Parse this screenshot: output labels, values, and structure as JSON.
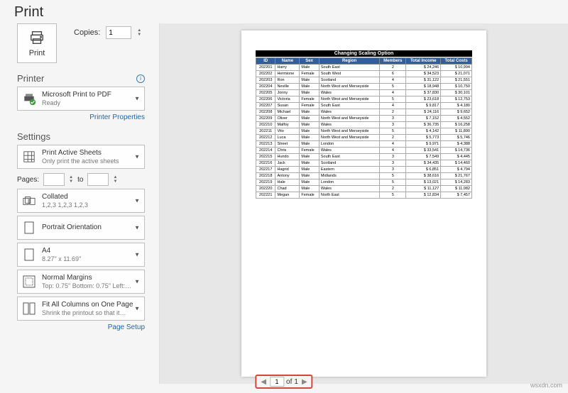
{
  "title": "Print",
  "printButton": "Print",
  "copiesLabel": "Copies:",
  "copiesValue": "1",
  "printerSection": "Printer",
  "printer": {
    "name": "Microsoft Print to PDF",
    "status": "Ready"
  },
  "printerPropsLink": "Printer Properties",
  "settingsSection": "Settings",
  "settings": {
    "activeSheets": {
      "t": "Print Active Sheets",
      "s": "Only print the active sheets"
    },
    "pagesLabel": "Pages:",
    "toLabel": "to",
    "collated": {
      "t": "Collated",
      "s": "1,2,3   1,2,3   1,2,3"
    },
    "orientation": {
      "t": "Portrait Orientation",
      "s": ""
    },
    "paper": {
      "t": "A4",
      "s": "8.27\" x 11.69\""
    },
    "margins": {
      "t": "Normal Margins",
      "s": "Top: 0.75\" Bottom: 0.75\" Left:…"
    },
    "scaling": {
      "t": "Fit All Columns on One Page",
      "s": "Shrink the printout so that it…"
    }
  },
  "pageSetupLink": "Page Setup",
  "preview": {
    "heading": "Changing Scaling Option",
    "cols": [
      "ID",
      "Name",
      "Sex",
      "Region",
      "Members",
      "Total Income",
      "Total Costs"
    ],
    "rows": [
      [
        "202201",
        "Harry",
        "Male",
        "South East",
        "2",
        "$   24,246",
        "$   10,994"
      ],
      [
        "202202",
        "Hermione",
        "Female",
        "South West",
        "6",
        "$   34,523",
        "$   21,071"
      ],
      [
        "202203",
        "Ron",
        "Male",
        "Scotland",
        "4",
        "$   31,122",
        "$   21,551"
      ],
      [
        "202204",
        "Neville",
        "Male",
        "North West and Merseyside",
        "5",
        "$   18,948",
        "$   10,750"
      ],
      [
        "202205",
        "Jonny",
        "Male",
        "Wales",
        "4",
        "$   37,830",
        "$   30,101"
      ],
      [
        "202206",
        "Victoria",
        "Female",
        "North West and Merseyside",
        "5",
        "$   23,618",
        "$   12,753"
      ],
      [
        "202207",
        "Susan",
        "Female",
        "South East",
        "4",
        "$    9,817",
        "$    4,180"
      ],
      [
        "202208",
        "Michael",
        "Male",
        "Wales",
        "2",
        "$   24,116",
        "$    9,652"
      ],
      [
        "202209",
        "Oliver",
        "Male",
        "North West and Merseyside",
        "3",
        "$    7,152",
        "$    4,552"
      ],
      [
        "202210",
        "Malfoy",
        "Male",
        "Wales",
        "3",
        "$   36,735",
        "$   16,258"
      ],
      [
        "202211",
        "Vito",
        "Male",
        "North West and Merseyside",
        "5",
        "$    4,142",
        "$   11,890"
      ],
      [
        "202212",
        "Luca",
        "Male",
        "North West and Merseyside",
        "2",
        "$    5,773",
        "$    5,746"
      ],
      [
        "202213",
        "Street",
        "Male",
        "London",
        "4",
        "$    9,971",
        "$    4,388"
      ],
      [
        "202214",
        "Chris",
        "Female",
        "Wales",
        "4",
        "$   33,541",
        "$   14,736"
      ],
      [
        "202215",
        "Hundo",
        "Male",
        "South East",
        "3",
        "$    7,549",
        "$    4,445"
      ],
      [
        "202216",
        "Jack",
        "Male",
        "Scotland",
        "3",
        "$   34,435",
        "$   14,460"
      ],
      [
        "202217",
        "Hagrid",
        "Male",
        "Eastern",
        "3",
        "$    6,851",
        "$    4,794"
      ],
      [
        "202218",
        "Antony",
        "Male",
        "Midlands",
        "5",
        "$   38,616",
        "$   21,767"
      ],
      [
        "202219",
        "Hale",
        "Male",
        "London",
        "5",
        "$   13,021",
        "$   14,283"
      ],
      [
        "202220",
        "Chad",
        "Male",
        "Wales",
        "2",
        "$   11,127",
        "$   11,082"
      ],
      [
        "202221",
        "Megan",
        "Female",
        "North East",
        "5",
        "$   12,834",
        "$    7,457"
      ]
    ]
  },
  "pager": {
    "current": "1",
    "ofLabel": "of",
    "total": "1"
  },
  "watermark": "wsxdn.com"
}
